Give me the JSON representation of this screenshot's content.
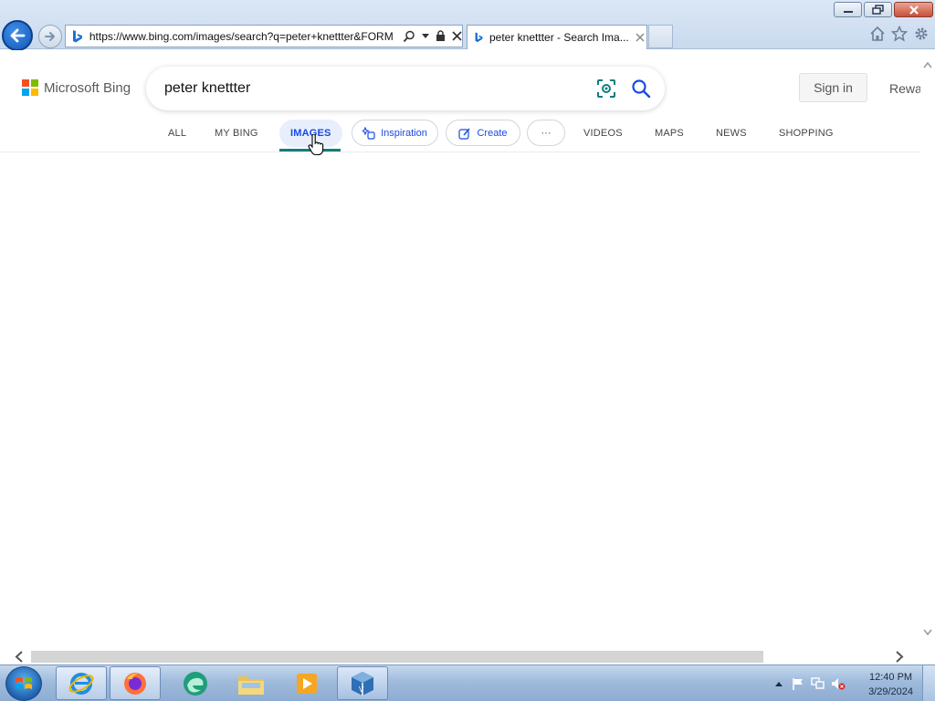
{
  "browser": {
    "address_url": "https://www.bing.com/images/search?q=peter+knettter&FORM",
    "tab_title": "peter knettter - Search Ima...",
    "window_buttons": [
      "minimize",
      "restore",
      "close"
    ],
    "tool_icons": [
      "home-icon",
      "star-icon",
      "gear-icon"
    ]
  },
  "bing": {
    "logo_text": "Microsoft Bing",
    "search_query": "peter knettter",
    "sign_in_label": "Sign in",
    "rewards_label": "Rewa",
    "scopes": {
      "all": "ALL",
      "mybing": "MY BING",
      "images": "IMAGES",
      "inspiration": "Inspiration",
      "create": "Create",
      "more": "···",
      "videos": "VIDEOS",
      "maps": "MAPS",
      "news": "NEWS",
      "shopping": "SHOPPING"
    },
    "active_scope": "IMAGES",
    "accent_color": "#174ae4",
    "underline_color": "#137d7d"
  },
  "taskbar": {
    "apps": [
      "internet-explorer",
      "firefox",
      "edge-canary",
      "file-explorer",
      "media-player",
      "virtualbox"
    ],
    "clock_time": "12:40 PM",
    "clock_date": "3/29/2024"
  }
}
